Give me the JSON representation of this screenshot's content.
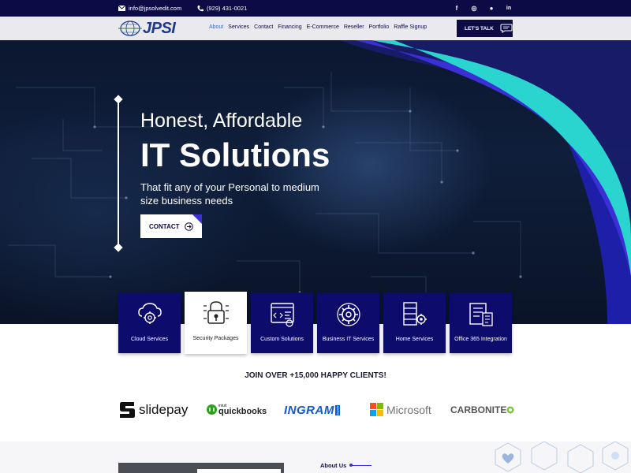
{
  "topbar": {
    "email": "info@jpsolvedit.com",
    "phone": "(929) 431-0021",
    "social": [
      {
        "icon": "facebook-icon",
        "glyph": "f"
      },
      {
        "icon": "instagram-icon",
        "glyph": "◎"
      },
      {
        "icon": "reddit-icon",
        "glyph": "●"
      },
      {
        "icon": "linkedin-icon",
        "glyph": "in"
      }
    ]
  },
  "nav": {
    "logo_text": "JPSI",
    "items": [
      "About",
      "Services",
      "Contact",
      "Financing",
      "E-Commerce",
      "Reseller",
      "Portfolio",
      "Raffle Signup"
    ],
    "active_index": 0,
    "cta_label": "LET'S TALK"
  },
  "hero": {
    "line1": "Honest, Affordable",
    "line2": "IT Solutions",
    "subtitle": "That fit any of your Personal to medium size business needs",
    "button_label": "CONTACT"
  },
  "services": [
    {
      "label": "Cloud Services",
      "icon": "cloud-gear-icon"
    },
    {
      "label": "Security Packages",
      "icon": "security-lock-icon"
    },
    {
      "label": "Custom Solutions",
      "icon": "code-window-icon"
    },
    {
      "label": "Business IT Services",
      "icon": "gear-icon"
    },
    {
      "label": "Home Services",
      "icon": "server-gear-icon"
    },
    {
      "label": "Office 365 Integration",
      "icon": "office-tools-icon"
    }
  ],
  "clients_heading": "JOIN OVER +15,000 HAPPY CLIENTS!",
  "clients": [
    {
      "name": "slidepay"
    },
    {
      "name": "quickbooks",
      "prefix": "intuit"
    },
    {
      "name": "INGRAM",
      "suffix": "MICRO"
    },
    {
      "name": "Microsoft"
    },
    {
      "name": "CARBONITE"
    }
  ],
  "about": {
    "label": "About Us"
  },
  "colors": {
    "navy": "#0d0b45",
    "card_blue": "#0d0b6b",
    "accent_purple": "#3b2fd6",
    "accent_teal": "#2ad4cf"
  }
}
